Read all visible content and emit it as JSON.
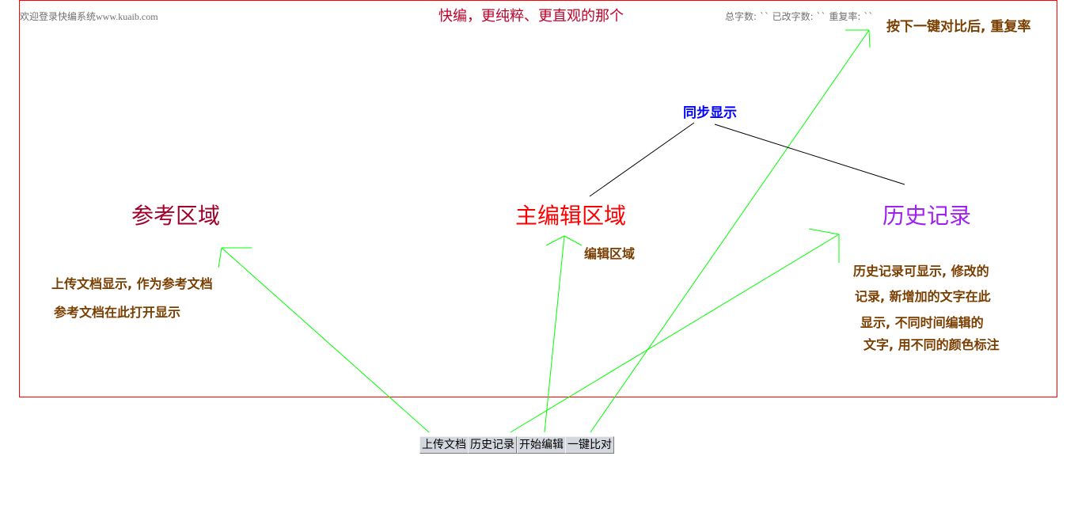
{
  "header": {
    "welcome": "欢迎登录快编系统www.kuaib.com",
    "slogan": "快编，更纯粹、更直观的那个",
    "stats": "总字数: `` 已改字数: `` 重复率: ``"
  },
  "annotations": {
    "compare_note": "按下一键对比后, 重复率",
    "sync_note": "同步显示",
    "edit_note": "编辑区域",
    "reference_note_1": "上传文档显示, 作为参考文档",
    "reference_note_2": "参考文档在此打开显示",
    "history_note_1": "历史记录可显示, 修改的",
    "history_note_2": "记录, 新增加的文字在此",
    "history_note_3": "显示, 不同时间编辑的",
    "history_note_4": "文字, 用不同的颜色标注"
  },
  "regions": {
    "reference": "参考区域",
    "main_edit": "主编辑区域",
    "history": "历史记录"
  },
  "buttons": {
    "upload": "上传文档",
    "history": "历史记录",
    "start_edit": "开始编辑",
    "compare": "一键比对"
  },
  "colors": {
    "border": "#ff0000",
    "arrow": "#00ff00",
    "note": "#7a3e00",
    "sync": "#0000ff",
    "reference_region": "#a0002a",
    "main_region": "#ff0000",
    "history_region": "#a020f0"
  }
}
